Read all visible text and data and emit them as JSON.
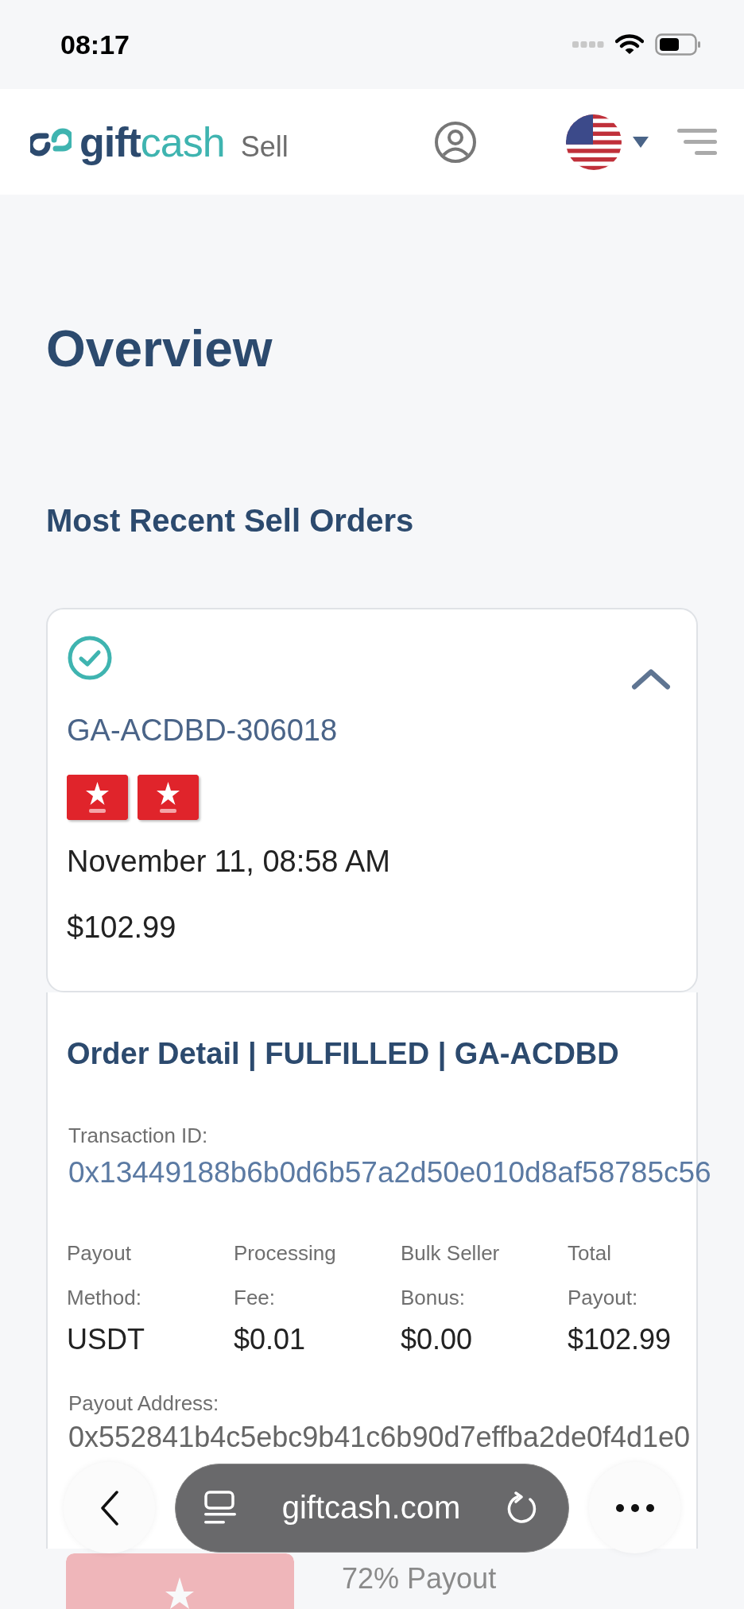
{
  "status_bar": {
    "time": "08:17"
  },
  "header": {
    "brand_dark": "gift",
    "brand_light": "cash",
    "section": "Sell"
  },
  "page_title": "Overview",
  "section_title": "Most Recent Sell Orders",
  "order": {
    "completed": true,
    "expanded": true,
    "id": "GA-ACDBD-306018",
    "date": "November 11, 08:58 AM",
    "amount": "$102.99",
    "detail": {
      "title": "Order Detail | FULFILLED | GA-ACDBD",
      "transaction_label": "Transaction ID:",
      "transaction_id": "0x13449188b6b0d6b57a2d50e010d8af58785c56",
      "summary": [
        {
          "label": "Payout Method:",
          "value": "USDT"
        },
        {
          "label": "Processing Fee:",
          "value": "$0.01"
        },
        {
          "label": "Bulk Seller Bonus:",
          "value": "$0.00"
        },
        {
          "label": "Total Payout:",
          "value": "$102.99"
        }
      ],
      "address_label": "Payout Address:",
      "address": "0x552841b4c5ebc9b41c6b90d7effba2de0f4d1e0"
    }
  },
  "next_order": {
    "payout": "72% Payout"
  },
  "browser_bar": {
    "url": "giftcash.com"
  }
}
